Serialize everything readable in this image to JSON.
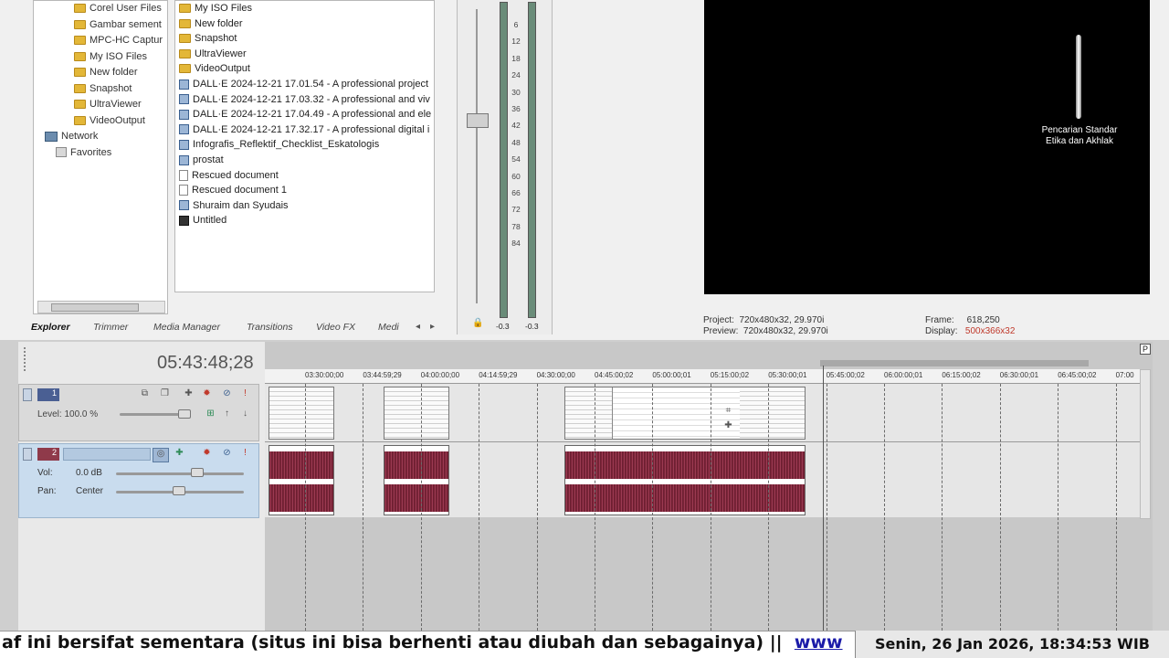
{
  "explorer": {
    "tree": [
      {
        "label": "Corel User Files",
        "type": "folder"
      },
      {
        "label": "Gambar sement",
        "type": "folder"
      },
      {
        "label": "MPC-HC Captur",
        "type": "folder"
      },
      {
        "label": "My ISO Files",
        "type": "folder"
      },
      {
        "label": "New folder",
        "type": "folder"
      },
      {
        "label": "Snapshot",
        "type": "folder"
      },
      {
        "label": "UltraViewer",
        "type": "folder"
      },
      {
        "label": "VideoOutput",
        "type": "folder"
      },
      {
        "label": "Network",
        "type": "network"
      },
      {
        "label": "Favorites",
        "type": "favorites"
      }
    ],
    "files": [
      {
        "label": "My ISO Files",
        "icon": "folder"
      },
      {
        "label": "New folder",
        "icon": "folder"
      },
      {
        "label": "Snapshot",
        "icon": "folder"
      },
      {
        "label": "UltraViewer",
        "icon": "folder"
      },
      {
        "label": "VideoOutput",
        "icon": "folder"
      },
      {
        "label": "DALL·E 2024-12-21 17.01.54 - A professional project",
        "icon": "image"
      },
      {
        "label": "DALL·E 2024-12-21 17.03.32 - A professional and viv",
        "icon": "image"
      },
      {
        "label": "DALL·E 2024-12-21 17.04.49 - A professional and ele",
        "icon": "image"
      },
      {
        "label": "DALL·E 2024-12-21 17.32.17 - A professional digital i",
        "icon": "image"
      },
      {
        "label": "Infografis_Reflektif_Checklist_Eskatologis",
        "icon": "image"
      },
      {
        "label": "prostat",
        "icon": "image"
      },
      {
        "label": "Rescued document",
        "icon": "document"
      },
      {
        "label": "Rescued document 1",
        "icon": "document"
      },
      {
        "label": "Shuraim dan Syudais",
        "icon": "image"
      },
      {
        "label": "Untitled",
        "icon": "vegas"
      }
    ],
    "tabs": [
      "Explorer",
      "Trimmer",
      "Media Manager",
      "Transitions",
      "Video FX",
      "Medi"
    ]
  },
  "meter": {
    "labels": [
      "6",
      "12",
      "18",
      "24",
      "30",
      "36",
      "42",
      "48",
      "54",
      "60",
      "66",
      "72",
      "78",
      "84"
    ],
    "peak_left": "-0.3",
    "peak_right": "-0.3"
  },
  "preview": {
    "overlay_line1": "Pencarian Standar",
    "overlay_line2": "Etika dan Akhlak",
    "project_label": "Project:",
    "project_value": "720x480x32, 29.970i",
    "preview_label": "Preview:",
    "preview_value": "720x480x32, 29.970i",
    "frame_label": "Frame:",
    "frame_value": "618,250",
    "display_label": "Display:",
    "display_value": "500x366x32"
  },
  "timeline": {
    "timecode": "05:43:48;28",
    "ruler": [
      "03:30:00;00",
      "03:44:59;29",
      "04:00:00;00",
      "04:14:59;29",
      "04:30:00;00",
      "04:45:00;02",
      "05:00:00;01",
      "05:15:00;02",
      "05:30:00;01",
      "05:45:00;02",
      "06:00:00;01",
      "06:15:00;02",
      "06:30:00;01",
      "06:45:00;02",
      "07:00"
    ],
    "video_track": {
      "number": "1",
      "level_label": "Level:",
      "level_value": "100.0 %"
    },
    "audio_track": {
      "number": "2",
      "vol_label": "Vol:",
      "vol_value": "0.0 dB",
      "pan_label": "Pan:",
      "pan_value": "Center"
    },
    "marker_p": "P"
  },
  "ticker": {
    "text": "af ini bersifat sementara (situs ini bisa berhenti atau diubah dan sebagainya)   ||",
    "link": "www",
    "clock": "Senin, 26 Jan 2026, 18:34:53 WIB"
  },
  "colors": {
    "audio_wave": "#7a2437",
    "preview_bg": "#000000",
    "display_value": "#c0392b"
  }
}
